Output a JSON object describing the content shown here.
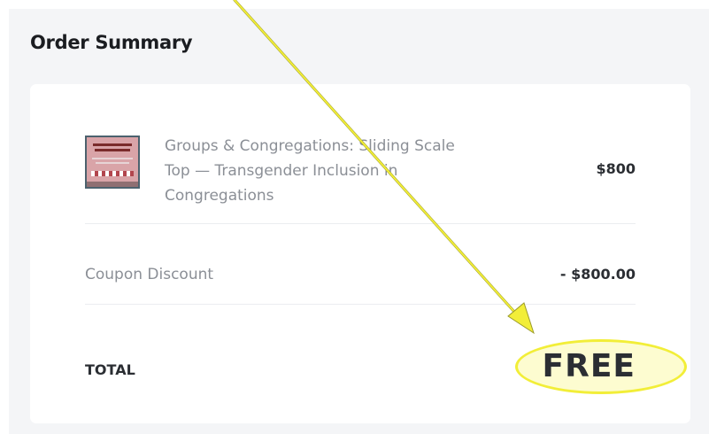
{
  "order_summary": {
    "heading": "Order Summary",
    "product": {
      "thumbnail": "transgender-inclusion-congregations-cover",
      "name": "Groups & Congregations: Sliding Scale Top — Transgender Inclusion in Congregations",
      "price": "$800"
    },
    "coupon": {
      "label": "Coupon Discount",
      "value": "- $800.00"
    },
    "total": {
      "label": "TOTAL",
      "value": "FREE"
    }
  },
  "annotation": {
    "color": "#f2ee38",
    "icon": "arrow-icon"
  }
}
